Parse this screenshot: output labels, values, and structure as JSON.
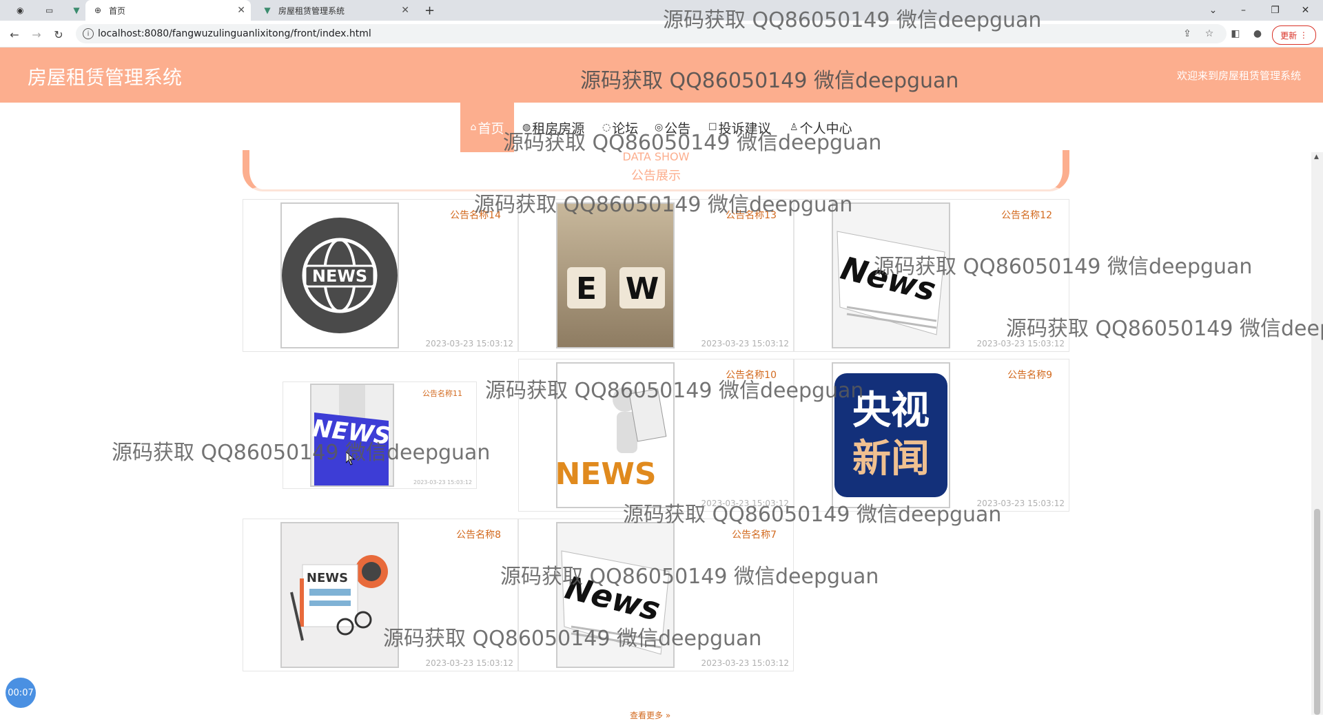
{
  "browser": {
    "tabs": [
      {
        "title": "首页",
        "active": true
      },
      {
        "title": "房屋租赁管理系统",
        "active": false
      }
    ],
    "new_tab": "+",
    "url": "localhost:8080/fangwuzulinguanlixitong/front/index.html",
    "update_label": "更新"
  },
  "header": {
    "title": "房屋租赁管理系统",
    "welcome": "欢迎来到房屋租赁管理系统"
  },
  "menu": {
    "items": [
      {
        "label": "首页",
        "icon": "home-icon",
        "active": true
      },
      {
        "label": "租房房源",
        "icon": "house-icon",
        "active": false
      },
      {
        "label": "论坛",
        "icon": "forum-icon",
        "active": false
      },
      {
        "label": "公告",
        "icon": "notice-icon",
        "active": false
      },
      {
        "label": "投诉建议",
        "icon": "feedback-icon",
        "active": false
      },
      {
        "label": "个人中心",
        "icon": "user-icon",
        "active": false
      }
    ]
  },
  "section": {
    "en_title": "DATA SHOW",
    "cn_title": "公告展示"
  },
  "cards": [
    {
      "title": "公告名称14",
      "date": "2023-03-23 15:03:12",
      "image": "globe-news"
    },
    {
      "title": "公告名称13",
      "date": "2023-03-23 15:03:12",
      "image": "news-blocks"
    },
    {
      "title": "公告名称12",
      "date": "2023-03-23 15:03:12",
      "image": "newspaper"
    },
    {
      "title": "公告名称11",
      "date": "2023-03-23 15:03:12",
      "image": "news-button"
    },
    {
      "title": "公告名称10",
      "date": "2023-03-23 15:03:12",
      "image": "news-man"
    },
    {
      "title": "公告名称9",
      "date": "2023-03-23 15:03:12",
      "image": "cctv-news"
    },
    {
      "title": "公告名称8",
      "date": "2023-03-23 15:03:12",
      "image": "news-flat"
    },
    {
      "title": "公告名称7",
      "date": "2023-03-23 15:03:12",
      "image": "newspaper"
    }
  ],
  "cctv_text": [
    "央视",
    "新闻"
  ],
  "watermark_text": "源码获取 QQ86050149 微信deepguan",
  "timer": "00:07",
  "footer_hint": "查看更多 »",
  "colors": {
    "accent": "#fcae8e",
    "title_text": "#d2691e"
  }
}
